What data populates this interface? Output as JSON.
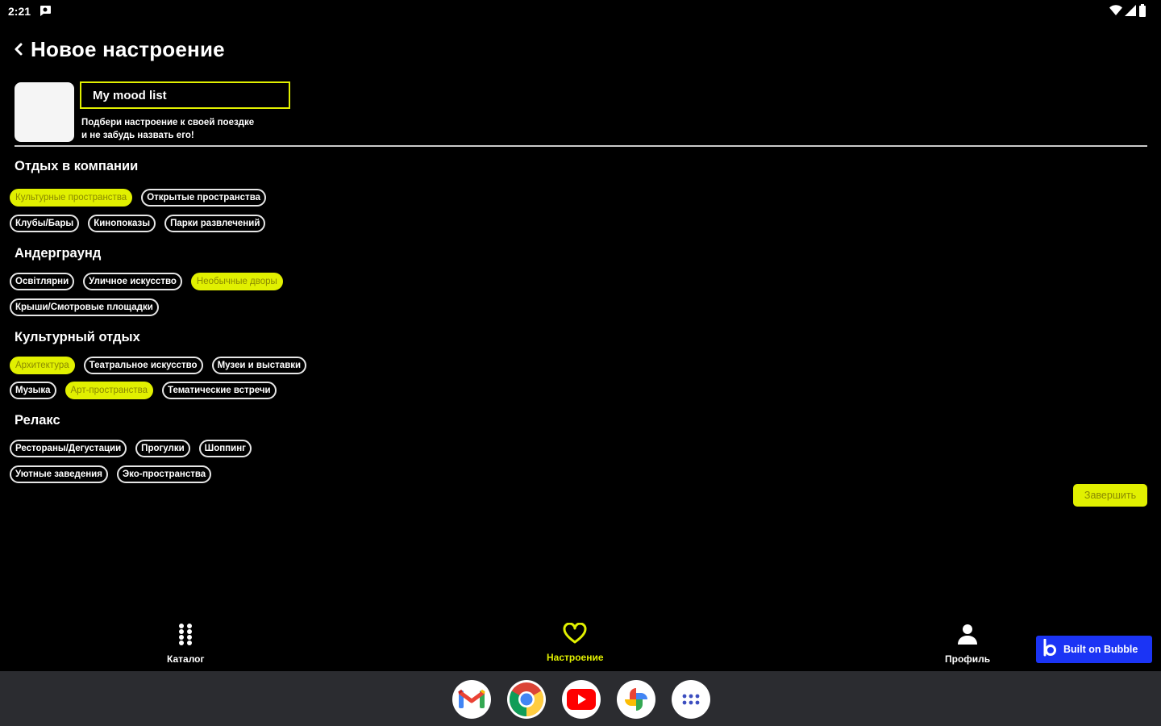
{
  "status_bar": {
    "time": "2:21"
  },
  "header": {
    "title": "Новое настроение"
  },
  "form": {
    "name_value": "My mood list",
    "hint": "Подбери настроение к своей поездке\nи не забудь назвать его!"
  },
  "sections": [
    {
      "title": "Отдых в компании",
      "rows": [
        [
          {
            "label": "Культурные пространства",
            "selected": true
          },
          {
            "label": "Открытые пространства",
            "selected": false
          }
        ],
        [
          {
            "label": "Клубы/Бары",
            "selected": false
          },
          {
            "label": "Кинопоказы",
            "selected": false
          },
          {
            "label": "Парки развлечений",
            "selected": false
          }
        ]
      ]
    },
    {
      "title": "Андерграунд",
      "rows": [
        [
          {
            "label": "Освітлярни",
            "selected": false
          },
          {
            "label": "Уличное искусство",
            "selected": false
          },
          {
            "label": "Необычные дворы",
            "selected": true
          }
        ],
        [
          {
            "label": "Крыши/Смотровые площадки",
            "selected": false
          }
        ]
      ]
    },
    {
      "title": "Культурный отдых",
      "rows": [
        [
          {
            "label": "Архитектура",
            "selected": true
          },
          {
            "label": "Театральное искусство",
            "selected": false
          },
          {
            "label": "Музеи и выставки",
            "selected": false
          }
        ],
        [
          {
            "label": "Музыка",
            "selected": false
          },
          {
            "label": "Арт-пространства",
            "selected": true
          },
          {
            "label": "Тематические встречи",
            "selected": false
          }
        ]
      ]
    },
    {
      "title": "Релакс",
      "rows": [
        [
          {
            "label": "Рестораны/Дегустации",
            "selected": false
          },
          {
            "label": "Прогулки",
            "selected": false
          },
          {
            "label": "Шоппинг",
            "selected": false
          }
        ],
        [
          {
            "label": "Уютные заведения",
            "selected": false
          },
          {
            "label": "Эко-пространства",
            "selected": false
          }
        ]
      ]
    }
  ],
  "finish_label": "Завершить",
  "bottom_nav": {
    "catalog": "Каталог",
    "mood": "Настроение",
    "profile": "Профиль"
  },
  "bubble_badge": "Built on Bubble",
  "dock_apps": [
    "gmail-icon",
    "chrome-icon",
    "youtube-icon",
    "photos-icon",
    "app-drawer-icon"
  ],
  "colors": {
    "accent": "#e1f000",
    "background": "#000000",
    "bubble": "#1b34f5",
    "taskbar": "#2b2c30"
  }
}
